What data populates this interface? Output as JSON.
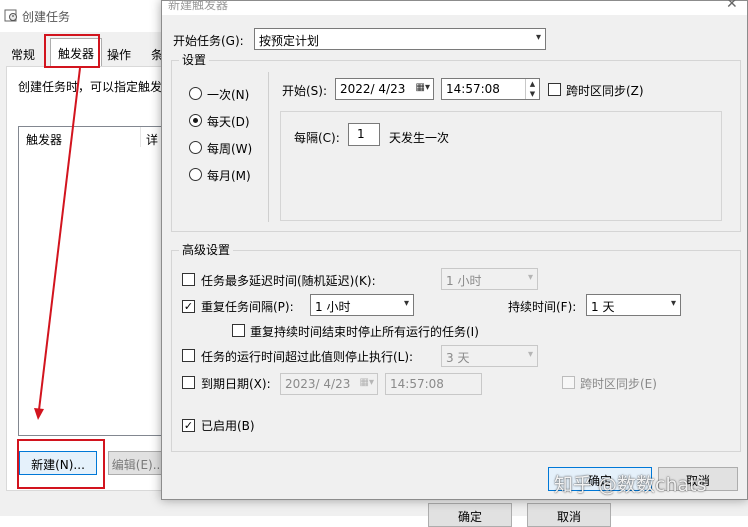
{
  "background_window": {
    "title": "创建任务",
    "tabs": [
      "常规",
      "触发器",
      "操作",
      "条"
    ],
    "description": "创建任务时，可以指定触发",
    "list_columns": [
      "触发器",
      "详"
    ],
    "new_button": "新建(N)...",
    "edit_button": "编辑(E)...",
    "ok_button": "确定",
    "cancel_button": "取消"
  },
  "dialog": {
    "title": "新建触发器",
    "close": "✕",
    "begin_task_label": "开始任务(G):",
    "begin_task_value": "按预定计划",
    "settings_label": "设置",
    "recurrence": [
      {
        "label": "一次(N)",
        "selected": false
      },
      {
        "label": "每天(D)",
        "selected": true
      },
      {
        "label": "每周(W)",
        "selected": false
      },
      {
        "label": "每月(M)",
        "selected": false
      }
    ],
    "start_label": "开始(S):",
    "start_date": "2022/  4/23",
    "start_time": "14:57:08",
    "sync_timezone_label": "跨时区同步(Z)",
    "every_label": "每隔(C):",
    "every_value": "1",
    "every_suffix": "天发生一次",
    "advanced_label": "高级设置",
    "delay": {
      "label": "任务最多延迟时间(随机延迟)(K):",
      "checked": false,
      "value": "1 小时"
    },
    "repeat": {
      "label": "重复任务间隔(P):",
      "checked": true,
      "value": "1 小时",
      "duration_label": "持续时间(F):",
      "duration_value": "1 天"
    },
    "stop_at_end": {
      "label": "重复持续时间结束时停止所有运行的任务(I)",
      "checked": false
    },
    "stop_if_longer": {
      "label": "任务的运行时间超过此值则停止执行(L):",
      "checked": false,
      "value": "3 天"
    },
    "expire": {
      "label": "到期日期(X):",
      "checked": false,
      "date": "2023/  4/23",
      "time": "14:57:08",
      "sync_label": "跨时区同步(E)"
    },
    "enabled": {
      "label": "已启用(B)",
      "checked": true
    },
    "ok_button": "确定",
    "cancel_button": "取消"
  },
  "watermark": "知乎 @数数chats",
  "colors": {
    "annotation_red": "#d2141e",
    "focus_blue": "#0078d7"
  }
}
